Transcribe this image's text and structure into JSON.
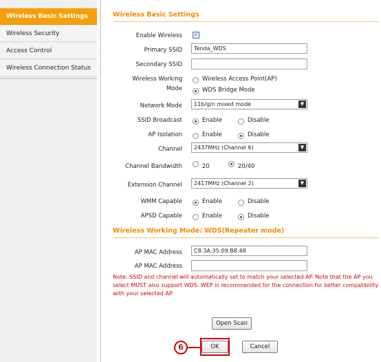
{
  "sidebar": {
    "items": [
      {
        "label": "Wireless Basic Settings",
        "active": true
      },
      {
        "label": "Wireless Security",
        "active": false
      },
      {
        "label": "Access Control",
        "active": false
      },
      {
        "label": "Wireless Connection Status",
        "active": false
      }
    ]
  },
  "basic": {
    "title": "Wireless Basic Settings",
    "enable_wireless_label": "Enable Wireless",
    "enable_wireless_checked": true,
    "primary_ssid_label": "Primary SSID",
    "primary_ssid_value": "Tenda_WDS",
    "secondary_ssid_label": "Secondary SSID",
    "secondary_ssid_value": "",
    "working_mode_label_1": "Wireless Working",
    "working_mode_label_2": "Mode",
    "working_mode_options": [
      "Wireless Access Point(AP)",
      "WDS Bridge Mode"
    ],
    "working_mode_selected": "WDS Bridge Mode",
    "network_mode_label": "Network Mode",
    "network_mode_value": "11b/g/n mixed mode",
    "ssid_broadcast_label": "SSID Broadcast",
    "ssid_broadcast_options": [
      "Enable",
      "Disable"
    ],
    "ssid_broadcast_selected": "Enable",
    "ap_isolation_label": "AP Isolation",
    "ap_isolation_options": [
      "Enable",
      "Disable"
    ],
    "ap_isolation_selected": "Disable",
    "channel_label": "Channel",
    "channel_value": "2437MHz (Channel 6)",
    "bandwidth_label": "Channel Bandwidth",
    "bandwidth_options": [
      "20",
      "20/40"
    ],
    "bandwidth_selected": "20/40",
    "extension_channel_label": "Extension Channel",
    "extension_channel_value": "2417MHz (Channel 2)",
    "wmm_label": "WMM Capable",
    "wmm_options": [
      "Enable",
      "Disable"
    ],
    "wmm_selected": "Enable",
    "apsd_label": "APSD Capable",
    "apsd_options": [
      "Enable",
      "Disable"
    ],
    "apsd_selected": "Disable"
  },
  "wds": {
    "title": "Wireless Working Mode: WDS(Repeater mode)",
    "ap_mac_label_1": "AP MAC Address",
    "ap_mac_value_1": "C8:3A:35:09:B8:48",
    "ap_mac_label_2": "AP MAC Address",
    "ap_mac_value_2": "",
    "note": "Note: SSID and channel will automatically set to match your selected AP. Note that the AP you select MUST also support WDS. WEP is recommended for the connection for better compatibility with your selected AP."
  },
  "buttons": {
    "open_scan": "Open Scan",
    "ok": "OK",
    "cancel": "Cancel"
  },
  "annotation": {
    "step_number": "6",
    "color": "#d40000"
  },
  "colors": {
    "accent": "#f5a00a",
    "section_title": "#f08c00",
    "note_text": "#d00000"
  }
}
